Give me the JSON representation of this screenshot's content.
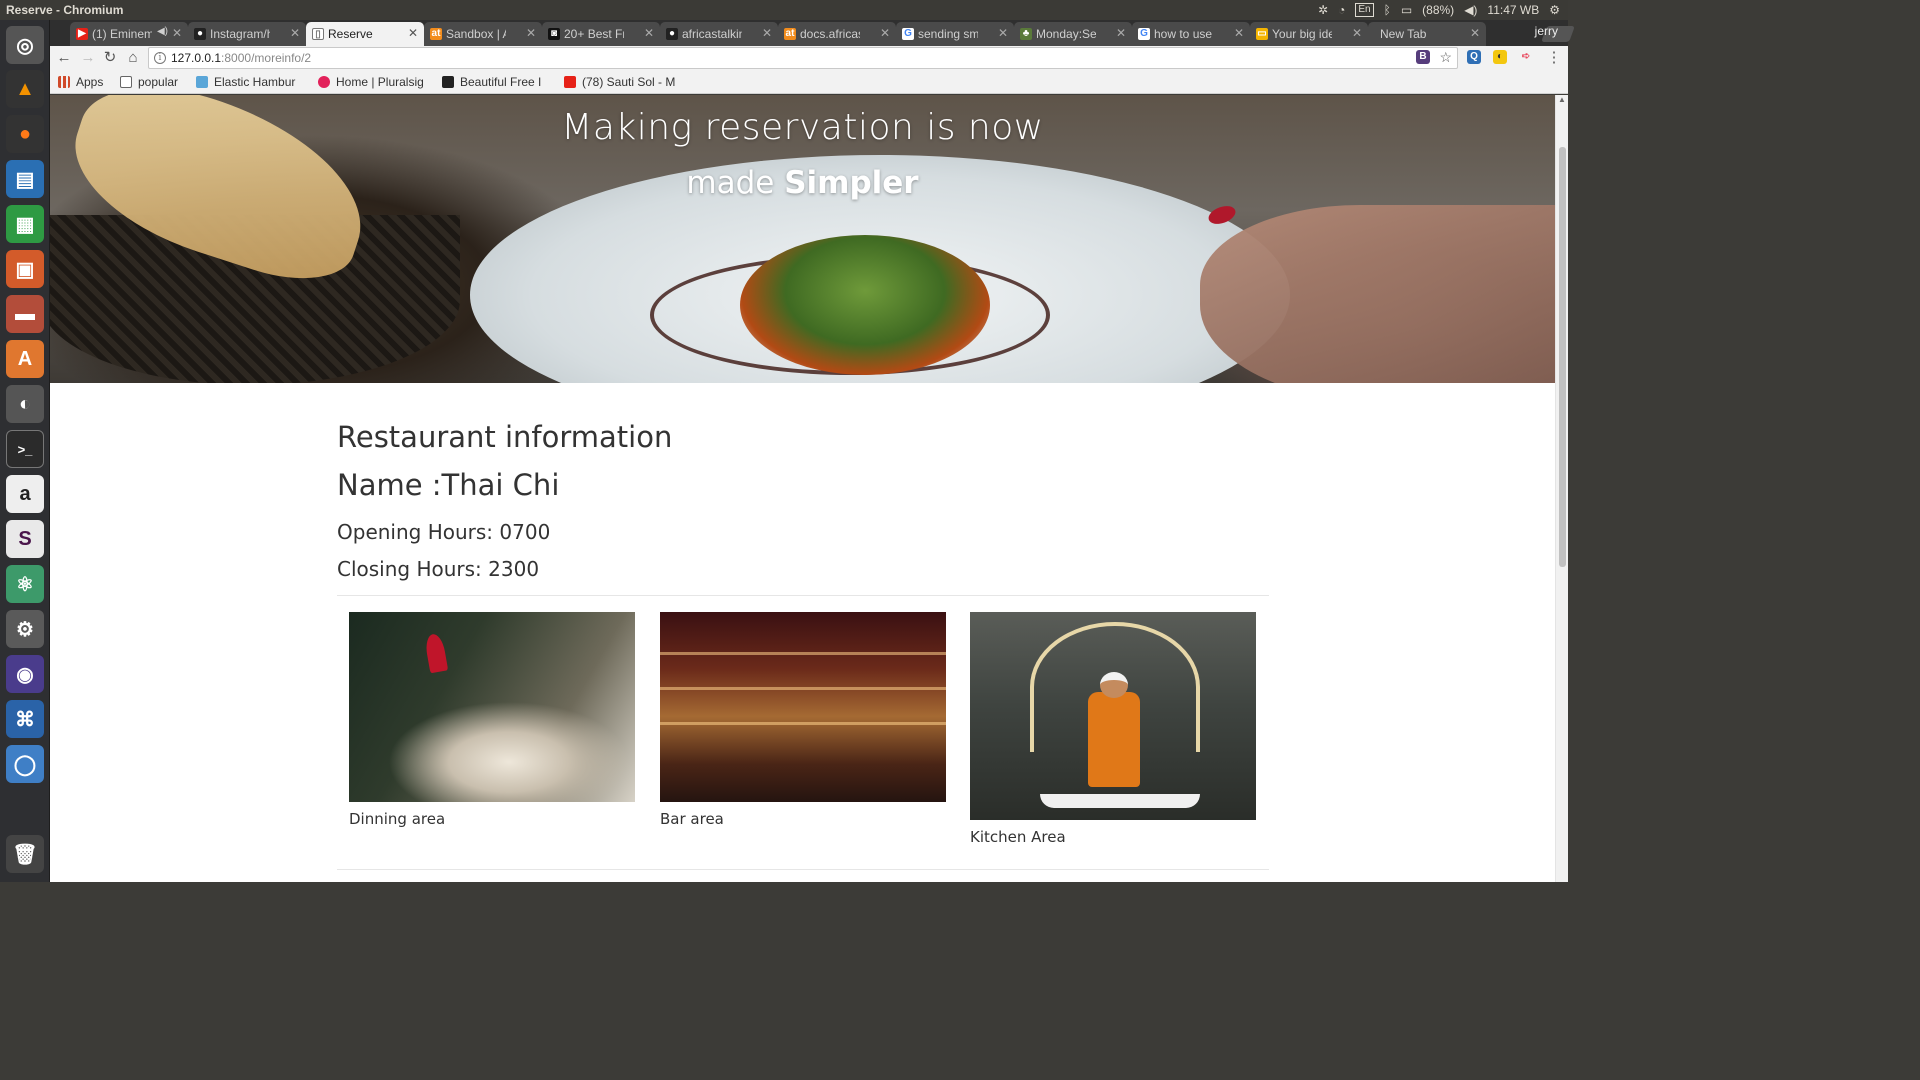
{
  "os_panel": {
    "window_title": "Reserve - Chromium",
    "keyboard_layout": "En",
    "battery": "(88%)",
    "clock": "11:47 WB",
    "icons": [
      "settings-icon",
      "wifi-icon",
      "bluetooth-icon",
      "battery-icon",
      "volume-icon",
      "power-icon"
    ]
  },
  "launcher": {
    "apps": [
      "ubuntu-dash",
      "vlc",
      "firefox",
      "libreoffice-writer",
      "libreoffice-calc",
      "libreoffice-impress",
      "files",
      "software-center",
      "disk-usage",
      "terminal",
      "amazon",
      "slack",
      "atom",
      "settings",
      "eclipse",
      "vscode",
      "chromium",
      "trash"
    ]
  },
  "browser": {
    "tabs": [
      {
        "label": "(1) Eminem",
        "icon": "youtube-icon",
        "audio": true
      },
      {
        "label": "Instagram/h",
        "icon": "github-icon"
      },
      {
        "label": "Reserve",
        "icon": "page-icon",
        "active": true
      },
      {
        "label": "Sandbox | Af",
        "icon": "africastalking-icon"
      },
      {
        "label": "20+ Best Fre",
        "icon": "camera-icon"
      },
      {
        "label": "africastalkin",
        "icon": "github-icon"
      },
      {
        "label": "docs.africas",
        "icon": "africastalking-icon"
      },
      {
        "label": "sending sms",
        "icon": "google-icon"
      },
      {
        "label": "Monday:Sen",
        "icon": "tree-icon"
      },
      {
        "label": "how to use a",
        "icon": "google-icon"
      },
      {
        "label": "Your big ide",
        "icon": "slides-icon"
      },
      {
        "label": "New Tab",
        "icon": ""
      }
    ],
    "user": "jerry",
    "url_host": "127.0.0.1",
    "url_rest": ":8000/moreinfo/2",
    "bookmarks": [
      {
        "label": "Apps",
        "icon": "apps-grid-icon"
      },
      {
        "label": "popular",
        "icon": "page-icon"
      },
      {
        "label": "Elastic Hambur",
        "icon": "folder-icon"
      },
      {
        "label": "Home | Pluralsig",
        "icon": "pluralsight-icon"
      },
      {
        "label": "Beautiful Free I",
        "icon": "camera-icon"
      },
      {
        "label": "(78) Sauti Sol - M",
        "icon": "youtube-icon"
      }
    ],
    "extensions": [
      "bootstrap-ext",
      "search-ext",
      "moon-ext",
      "arrow-ext"
    ]
  },
  "hero": {
    "title": "Making reservation is now",
    "sub_prefix": "made",
    "sub_bold": "Simpler"
  },
  "restaurant": {
    "heading": "Restaurant information",
    "name": "Name :Thai Chi",
    "opening": "Opening Hours: 0700",
    "closing": "Closing Hours: 2300"
  },
  "gallery": [
    {
      "caption": "Dinning area"
    },
    {
      "caption": "Bar area"
    },
    {
      "caption": "Kitchen Area"
    }
  ],
  "colors": {
    "panel": "#3b3a36",
    "launcher": "#2e2f32",
    "toolbar": "#f2f2f2",
    "text": "#333333"
  }
}
